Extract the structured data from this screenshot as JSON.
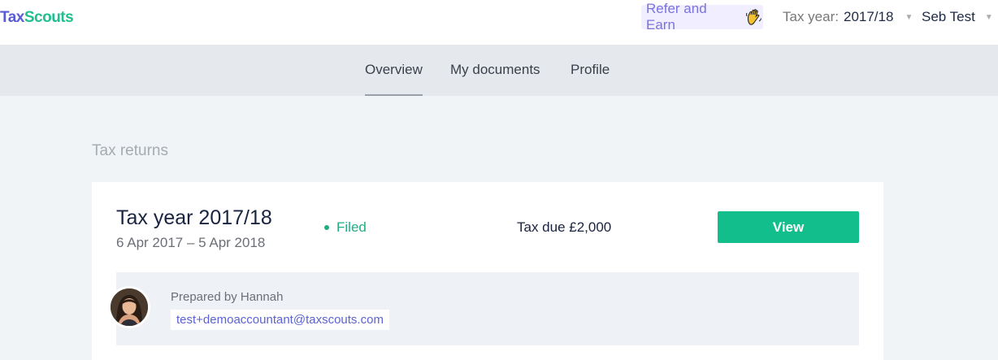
{
  "header": {
    "logo": {
      "part1": "Tax",
      "part2": "Scouts"
    },
    "refer": {
      "label": "Refer and Earn",
      "icon": "waving-hand-icon"
    },
    "tax_year": {
      "label": "Tax year:",
      "value": "2017/18"
    },
    "user": {
      "name": "Seb Test"
    }
  },
  "nav": {
    "tabs": [
      {
        "label": "Overview",
        "active": true
      },
      {
        "label": "My documents",
        "active": false
      },
      {
        "label": "Profile",
        "active": false
      }
    ]
  },
  "main": {
    "section_title": "Tax returns",
    "card": {
      "title": "Tax year 2017/18",
      "dates": "6 Apr 2017 – 5 Apr 2018",
      "status": "Filed",
      "tax_due": "Tax due £2,000",
      "view_label": "View",
      "preparer": {
        "prepared_by": "Prepared by Hannah",
        "email": "test+demoaccountant@taxscouts.com"
      }
    }
  },
  "colors": {
    "brand_purple": "#5b5bd6",
    "brand_green": "#1fbf8f",
    "button_green": "#12bf8c",
    "status_green": "#1fae84",
    "link_purple": "#5b62d6"
  }
}
